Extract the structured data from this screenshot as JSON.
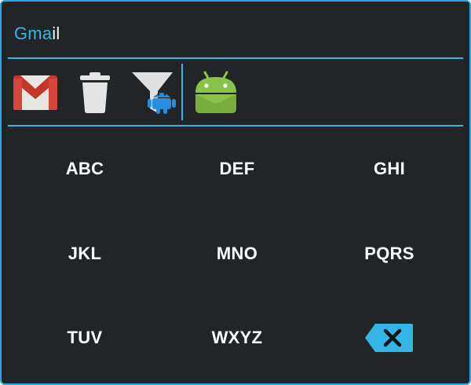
{
  "search": {
    "typed": "Gma",
    "completion": "il"
  },
  "app_strip": {
    "items": [
      {
        "name": "gmail",
        "icon": "gmail-icon"
      },
      {
        "name": "trash",
        "icon": "trash-icon"
      },
      {
        "name": "filter",
        "icon": "android-filter-icon"
      },
      {
        "name": "android",
        "icon": "android-icon"
      }
    ]
  },
  "keypad": {
    "keys": [
      "ABC",
      "DEF",
      "GHI",
      "JKL",
      "MNO",
      "PQRS",
      "TUV",
      "WXYZ"
    ],
    "backspace_icon": "backspace-icon"
  },
  "colors": {
    "accent": "#33b5e5",
    "background": "#212528",
    "gmail_red": "#d8453a",
    "android_green": "#8bc34a",
    "android_blue": "#2a8ee0"
  }
}
